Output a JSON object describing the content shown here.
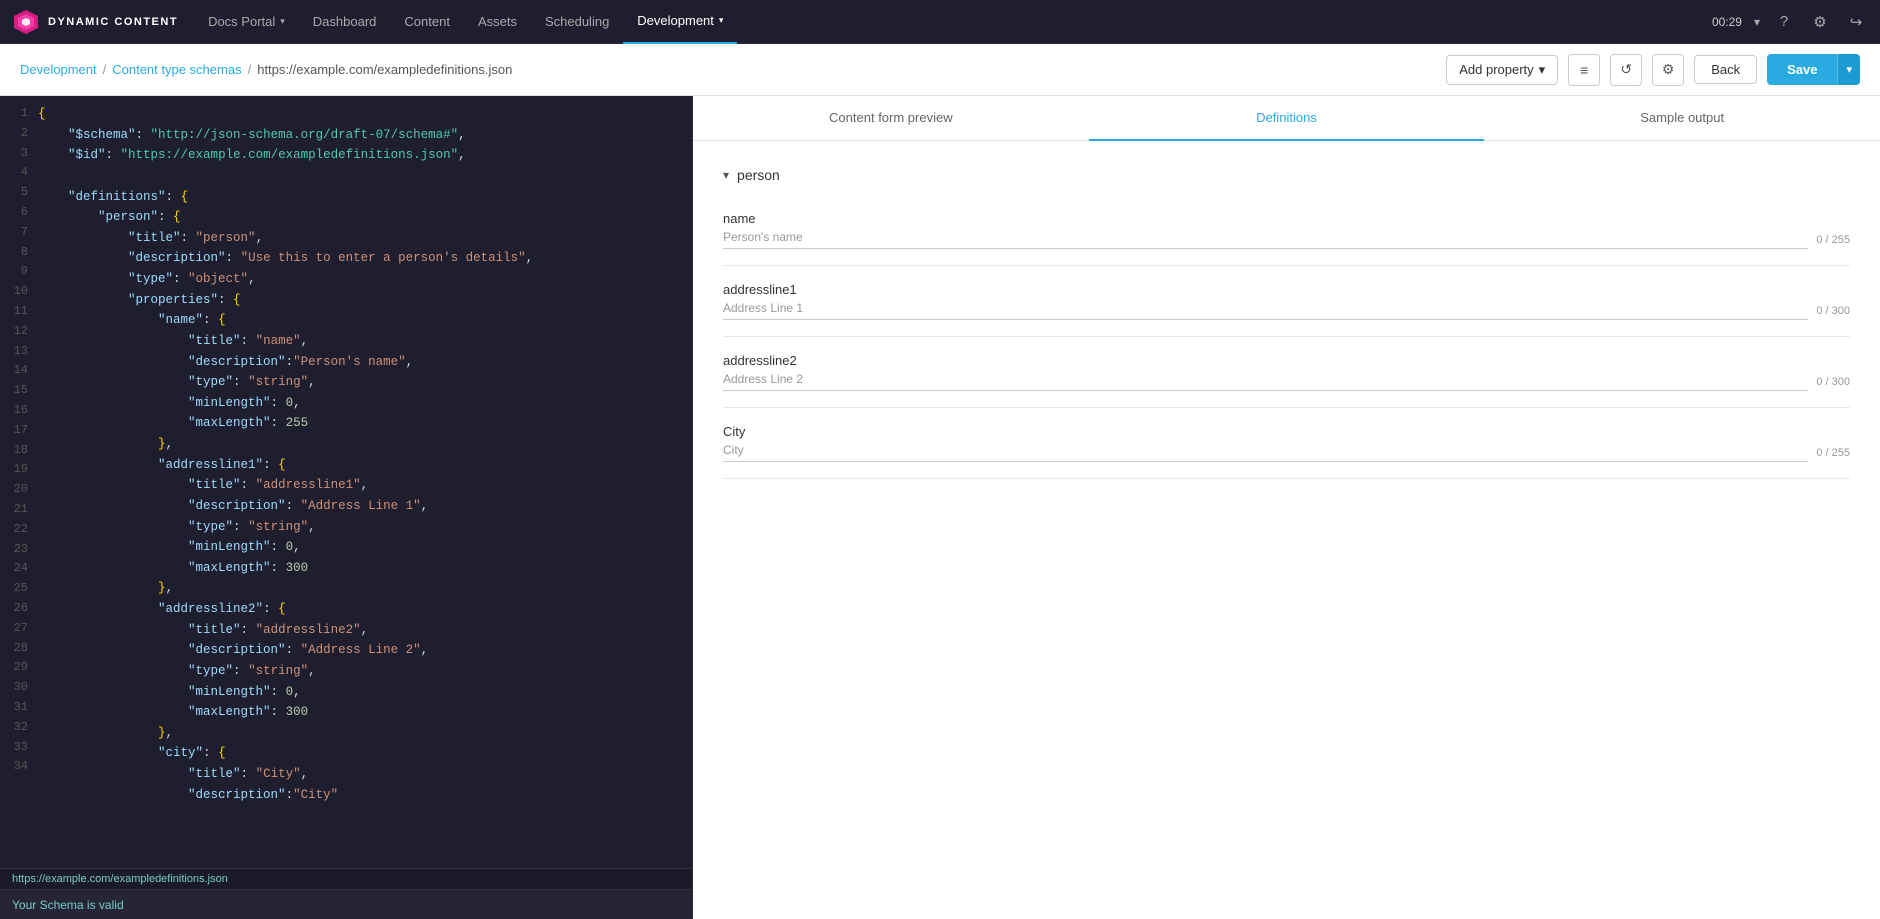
{
  "app": {
    "logo_text": "DYNAMIC CONTENT",
    "nav_items": [
      {
        "label": "Docs Portal",
        "has_chevron": true,
        "active": false
      },
      {
        "label": "Dashboard",
        "has_chevron": false,
        "active": false
      },
      {
        "label": "Content",
        "has_chevron": false,
        "active": false
      },
      {
        "label": "Assets",
        "has_chevron": false,
        "active": false
      },
      {
        "label": "Scheduling",
        "has_chevron": false,
        "active": false
      },
      {
        "label": "Development",
        "has_chevron": true,
        "active": true
      }
    ],
    "time": "00:29",
    "breadcrumb": {
      "development": "Development",
      "separator1": "/",
      "content_type": "Content type schemas",
      "separator2": "/",
      "url": "https://example.com/exampledefinitions.json"
    },
    "toolbar": {
      "add_property": "Add property",
      "back": "Back",
      "save": "Save"
    },
    "status_url": "https://example.com/exampledefinitions.json",
    "status_message": "Your Schema is valid"
  },
  "editor": {
    "lines": [
      {
        "num": 1,
        "content": "{"
      },
      {
        "num": 2,
        "content": "    \"$schema\": \"http://json-schema.org/draft-07/schema#\","
      },
      {
        "num": 3,
        "content": "    \"$id\": \"https://example.com/exampledefinitions.json\","
      },
      {
        "num": 4,
        "content": ""
      },
      {
        "num": 5,
        "content": "    \"definitions\": {"
      },
      {
        "num": 6,
        "content": "        \"person\": {"
      },
      {
        "num": 7,
        "content": "            \"title\": \"person\","
      },
      {
        "num": 8,
        "content": "            \"description\": \"Use this to enter a person's details\","
      },
      {
        "num": 9,
        "content": "            \"type\": \"object\","
      },
      {
        "num": 10,
        "content": "            \"properties\": {"
      },
      {
        "num": 11,
        "content": "                \"name\": {"
      },
      {
        "num": 12,
        "content": "                    \"title\": \"name\","
      },
      {
        "num": 13,
        "content": "                    \"description\":\"Person's name\","
      },
      {
        "num": 14,
        "content": "                    \"type\": \"string\","
      },
      {
        "num": 15,
        "content": "                    \"minLength\": 0,"
      },
      {
        "num": 16,
        "content": "                    \"maxLength\": 255"
      },
      {
        "num": 17,
        "content": "                },"
      },
      {
        "num": 18,
        "content": "                \"addressline1\": {"
      },
      {
        "num": 19,
        "content": "                    \"title\": \"addressline1\","
      },
      {
        "num": 20,
        "content": "                    \"description\": \"Address Line 1\","
      },
      {
        "num": 21,
        "content": "                    \"type\": \"string\","
      },
      {
        "num": 22,
        "content": "                    \"minLength\": 0,"
      },
      {
        "num": 23,
        "content": "                    \"maxLength\": 300"
      },
      {
        "num": 24,
        "content": "                },"
      },
      {
        "num": 25,
        "content": "                \"addressline2\": {"
      },
      {
        "num": 26,
        "content": "                    \"title\": \"addressline2\","
      },
      {
        "num": 27,
        "content": "                    \"description\": \"Address Line 2\","
      },
      {
        "num": 28,
        "content": "                    \"type\": \"string\","
      },
      {
        "num": 29,
        "content": "                    \"minLength\": 0,"
      },
      {
        "num": 30,
        "content": "                    \"maxLength\": 300"
      },
      {
        "num": 31,
        "content": "                },"
      },
      {
        "num": 32,
        "content": "                \"city\": {"
      },
      {
        "num": 33,
        "content": "                    \"title\": \"City\","
      },
      {
        "num": 34,
        "content": "                    \"description\":\"City\""
      }
    ]
  },
  "right_panel": {
    "tabs": [
      {
        "label": "Content form preview",
        "active": false
      },
      {
        "label": "Definitions",
        "active": true
      },
      {
        "label": "Sample output",
        "active": false
      }
    ],
    "person_group": {
      "label": "person",
      "fields": [
        {
          "label": "name",
          "placeholder": "Person's name",
          "counter": "0 / 255"
        },
        {
          "label": "addressline1",
          "placeholder": "Address Line 1",
          "counter": "0 / 300"
        },
        {
          "label": "addressline2",
          "placeholder": "Address Line 2",
          "counter": "0 / 300"
        },
        {
          "label": "City",
          "placeholder": "City",
          "counter": "0 / 255"
        }
      ]
    }
  }
}
